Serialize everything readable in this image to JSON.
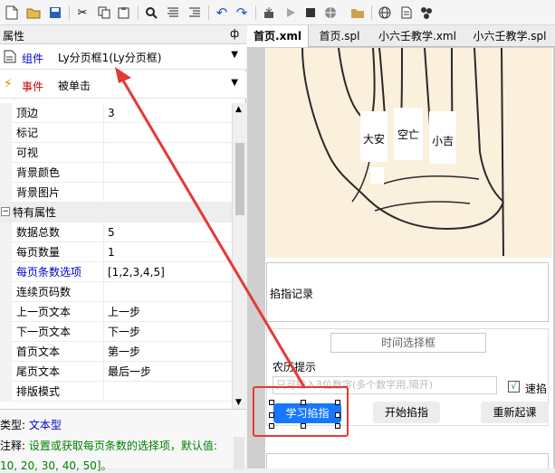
{
  "toolbar": {
    "icons": [
      "new-file-icon",
      "open-folder-icon",
      "save-icon",
      "cut-icon",
      "copy-icon",
      "paste-icon",
      "find-icon",
      "align-icon",
      "format-icon",
      "undo-icon",
      "redo-icon",
      "build-icon",
      "run-icon",
      "stop-icon",
      "globe-debug-icon",
      "folder-icon",
      "web-icon",
      "page-icon",
      "component-icon"
    ]
  },
  "properties_panel": {
    "title": "属性",
    "pin_glyph": "ф",
    "component_label": "组件",
    "component_value": "Ly分页框1(Ly分页框)",
    "event_label": "事件",
    "event_value": "被单击",
    "rows": [
      {
        "key": "顶边",
        "value": "3"
      },
      {
        "key": "标记",
        "value": ""
      },
      {
        "key": "可视",
        "value": ""
      },
      {
        "key": "背景颜色",
        "value": ""
      },
      {
        "key": "背景图片",
        "value": ""
      }
    ],
    "category": "特有属性",
    "special_rows": [
      {
        "key": "数据总数",
        "value": "5"
      },
      {
        "key": "每页数量",
        "value": "1"
      },
      {
        "key": "每页条数选项",
        "value": "[1,2,3,4,5]"
      },
      {
        "key": "连续页码数",
        "value": ""
      },
      {
        "key": "上一页文本",
        "value": "上一步"
      },
      {
        "key": "下一页文本",
        "value": "下一步"
      },
      {
        "key": "首页文本",
        "value": "第一步"
      },
      {
        "key": "尾页文本",
        "value": "最后一步"
      },
      {
        "key": "排版模式",
        "value": ""
      }
    ],
    "type_label": "类型:",
    "type_value": "文本型",
    "note_label": "注释:",
    "note_value": "设置或获取每页条数的选择项，默认值:",
    "note_value2": "10, 20, 30, 40, 50]。"
  },
  "tabs": [
    {
      "label": "首页.xml",
      "active": true
    },
    {
      "label": "首页.spl",
      "active": false
    },
    {
      "label": "小六壬教学.xml",
      "active": false
    },
    {
      "label": "小六壬教学.spl",
      "active": false
    }
  ],
  "design": {
    "palm_labels": [
      "大安",
      "空亡",
      "小吉"
    ],
    "record_label": "掐指记录",
    "time_picker": "时间选择框",
    "lunar_hint": "农历提示",
    "input_placeholder": "只可输入3位数字(多个数字用,隔开)",
    "speed_label": "速掐",
    "learn_button": "学习掐指",
    "start_button": "开始掐指",
    "reset_button": "重新起课"
  },
  "colors": {
    "accent_blue": "#1677ff",
    "annotation_red": "#e53935",
    "link_blue": "#0000cc",
    "note_green": "#008000"
  }
}
